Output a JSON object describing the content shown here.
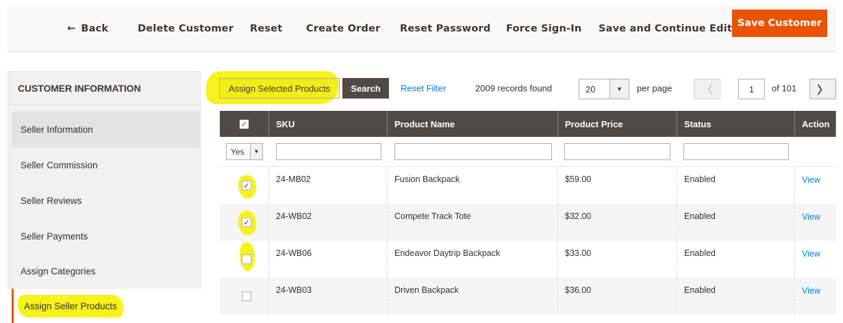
{
  "topbar": {
    "back_label": "Back",
    "delete_label": "Delete Customer",
    "reset_label": "Reset",
    "create_order_label": "Create Order",
    "reset_password_label": "Reset Password",
    "force_signin_label": "Force Sign-In",
    "save_continue_label": "Save and Continue Edit",
    "save_label": "Save Customer"
  },
  "sidebar": {
    "title": "CUSTOMER INFORMATION",
    "items": [
      {
        "label": "Seller Information"
      },
      {
        "label": "Seller Commission"
      },
      {
        "label": "Seller Reviews"
      },
      {
        "label": "Seller Payments"
      },
      {
        "label": "Assign Categories"
      },
      {
        "label": "Assign Seller Products"
      }
    ]
  },
  "toolbar": {
    "assign_selected_label": "Assign Selected Products",
    "search_label": "Search",
    "reset_filter_label": "Reset Filter",
    "records_found": "2009 records found",
    "per_page_value": "20",
    "per_page_label": "per page",
    "current_page": "1",
    "total_pages_label": "of 101"
  },
  "grid": {
    "columns": [
      "SKU",
      "Product Name",
      "Product Price",
      "Status",
      "Action"
    ],
    "filter_select_value": "Yes",
    "rows": [
      {
        "checked": true,
        "sku": "24-MB02",
        "name": "Fusion Backpack",
        "price": "$59.00",
        "status": "Enabled",
        "action": "View"
      },
      {
        "checked": true,
        "sku": "24-WB02",
        "name": "Compete Track Tote",
        "price": "$32.00",
        "status": "Enabled",
        "action": "View"
      },
      {
        "checked": false,
        "sku": "24-WB06",
        "name": "Endeavor Daytrip Backpack",
        "price": "$33.00",
        "status": "Enabled",
        "action": "View"
      },
      {
        "checked": false,
        "sku": "24-WB03",
        "name": "Driven Backpack",
        "price": "$36.00",
        "status": "Enabled",
        "action": "View"
      }
    ]
  },
  "colors": {
    "accent": "#eb5202",
    "header_bg": "#514943",
    "link": "#007bdb",
    "highlight": "#f7f21b"
  },
  "icons": {
    "back": "arrow-left-icon",
    "caret": "caret-down-icon",
    "prev": "chevron-left-icon",
    "next": "chevron-right-icon",
    "check": "checkmark-icon"
  }
}
